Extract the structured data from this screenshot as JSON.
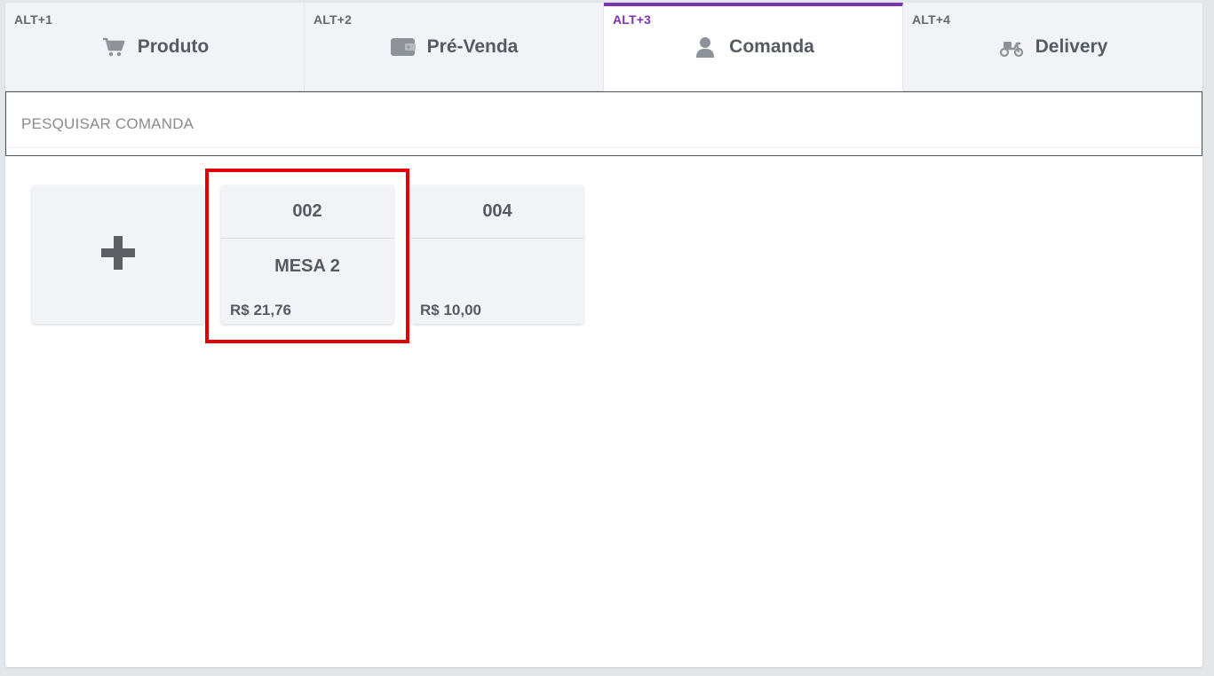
{
  "tabs": [
    {
      "shortcut": "ALT+1",
      "label": "Produto",
      "icon": "cart-icon",
      "active": false
    },
    {
      "shortcut": "ALT+2",
      "label": "Pré-Venda",
      "icon": "wallet-icon",
      "active": false
    },
    {
      "shortcut": "ALT+3",
      "label": "Comanda",
      "icon": "user-icon",
      "active": true
    },
    {
      "shortcut": "ALT+4",
      "label": "Delivery",
      "icon": "scooter-icon",
      "active": false
    }
  ],
  "search": {
    "placeholder": "PESQUISAR COMANDA",
    "value": ""
  },
  "add_card": {
    "icon": "plus-icon"
  },
  "comandas": [
    {
      "number": "002",
      "name": "MESA 2",
      "value": "R$ 21,76",
      "highlighted": true
    },
    {
      "number": "004",
      "name": "",
      "value": "R$ 10,00",
      "highlighted": false
    }
  ],
  "colors": {
    "accent": "#7b33b0",
    "highlight": "#e30000",
    "tab_bg": "#f2f3f6",
    "card_bg": "#f2f3f6",
    "page_bg": "#e4e7ea"
  }
}
